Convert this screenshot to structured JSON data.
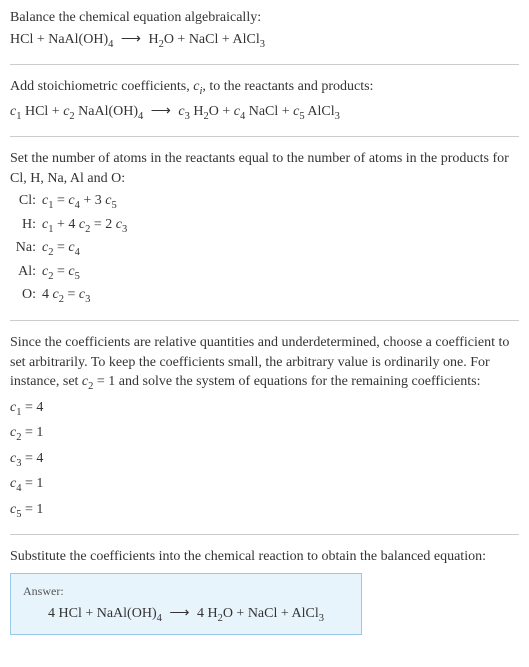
{
  "intro": {
    "line1": "Balance the chemical equation algebraically:",
    "eq_lhs1": "HCl + NaAl(OH)",
    "eq_sub1": "4",
    "eq_arrow": "⟶",
    "eq_rhs1": "H",
    "eq_sub2": "2",
    "eq_rhs2": "O + NaCl + AlCl",
    "eq_sub3": "3"
  },
  "step1": {
    "text1": "Add stoichiometric coefficients, ",
    "ci_c": "c",
    "ci_i": "i",
    "text2": ", to the reactants and products:",
    "c1": "c",
    "s1": "1",
    "t1": " HCl + ",
    "c2": "c",
    "s2": "2",
    "t2": " NaAl(OH)",
    "s2b": "4",
    "arrow": "⟶",
    "c3": "c",
    "s3": "3",
    "t3": " H",
    "s3b": "2",
    "t3c": "O + ",
    "c4": "c",
    "s4": "4",
    "t4": " NaCl + ",
    "c5": "c",
    "s5": "5",
    "t5": " AlCl",
    "s5b": "3"
  },
  "step2": {
    "text": "Set the number of atoms in the reactants equal to the number of atoms in the products for Cl, H, Na, Al and O:",
    "rows": [
      {
        "label": "Cl:",
        "parts": [
          "c",
          "1",
          " = ",
          "c",
          "4",
          " + 3 ",
          "c",
          "5"
        ]
      },
      {
        "label": "H:",
        "parts": [
          "c",
          "1",
          " + 4 ",
          "c",
          "2",
          " = 2 ",
          "c",
          "3"
        ]
      },
      {
        "label": "Na:",
        "parts": [
          "c",
          "2",
          " = ",
          "c",
          "4"
        ]
      },
      {
        "label": "Al:",
        "parts": [
          "c",
          "2",
          " = ",
          "c",
          "5"
        ]
      },
      {
        "label": "O:",
        "parts": [
          "4 ",
          "c",
          "2",
          " = ",
          "c",
          "3"
        ]
      }
    ]
  },
  "step3": {
    "text1": "Since the coefficients are relative quantities and underdetermined, choose a coefficient to set arbitrarily. To keep the coefficients small, the arbitrary value is ordinarily one. For instance, set ",
    "c2c": "c",
    "c2s": "2",
    "text2": " = 1 and solve the system of equations for the remaining coefficients:",
    "coefs": [
      {
        "c": "c",
        "s": "1",
        "v": " = 4"
      },
      {
        "c": "c",
        "s": "2",
        "v": " = 1"
      },
      {
        "c": "c",
        "s": "3",
        "v": " = 4"
      },
      {
        "c": "c",
        "s": "4",
        "v": " = 1"
      },
      {
        "c": "c",
        "s": "5",
        "v": " = 1"
      }
    ]
  },
  "step4": {
    "text": "Substitute the coefficients into the chemical reaction to obtain the balanced equation:"
  },
  "answer": {
    "label": "Answer:",
    "p1": "4 HCl + NaAl(OH)",
    "s1": "4",
    "arrow": "⟶",
    "p2": "4 H",
    "s2": "2",
    "p3": "O + NaCl + AlCl",
    "s3": "3"
  }
}
